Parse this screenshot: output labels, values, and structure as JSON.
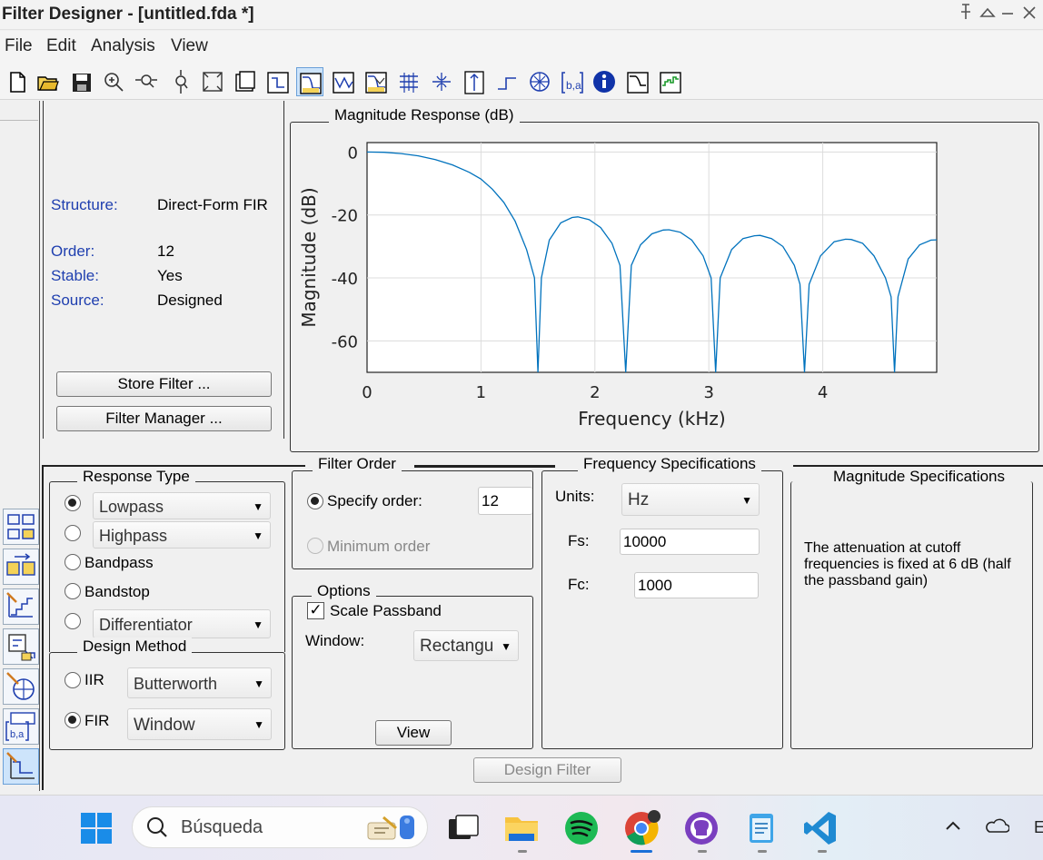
{
  "window": {
    "title": "Filter Designer - [untitled.fda *]",
    "controls": [
      "pin",
      "maximize",
      "minimize"
    ]
  },
  "menu": [
    "File",
    "Edit",
    "Analysis",
    "View"
  ],
  "toolbar_icons": [
    "new-file-icon",
    "open-folder-icon",
    "save-icon",
    "zoom-in-icon",
    "zoom-x-icon",
    "zoom-y-icon",
    "full-view-icon",
    "filter-spec-icon",
    "pole-zero-spec-icon",
    "magnitude-response-icon",
    "phase-response-icon",
    "magnitude-phase-icon",
    "group-delay-icon",
    "phase-delay-icon",
    "impulse-response-icon",
    "step-response-icon",
    "pole-zero-plot-icon",
    "filter-coefficients-icon",
    "filter-information-icon",
    "magnitude-estimate-icon",
    "round-off-noise-icon"
  ],
  "info_panel": {
    "structure_label": "Structure:",
    "structure_value": "Direct-Form FIR",
    "order_label": "Order:",
    "order_value": "12",
    "stable_label": "Stable:",
    "stable_value": "Yes",
    "source_label": "Source:",
    "source_value": "Designed",
    "store_button": "Store Filter ...",
    "manager_button": "Filter Manager ..."
  },
  "plot": {
    "panel_title": "Magnitude Response (dB)",
    "line_color": "#0072bd"
  },
  "chart_data": {
    "type": "line",
    "title": "Magnitude Response (dB)",
    "xlabel": "Frequency (kHz)",
    "ylabel": "Magnitude (dB)",
    "xlim": [
      0,
      5
    ],
    "ylim": [
      -70,
      3
    ],
    "x_ticks": [
      "0",
      "1",
      "2",
      "3",
      "4"
    ],
    "y_ticks": [
      "0",
      "-20",
      "-40",
      "-60"
    ],
    "grid": true,
    "series": [
      {
        "x": [
          0,
          0.15,
          0.3,
          0.45,
          0.6,
          0.75,
          0.9,
          1.0,
          1.1,
          1.2,
          1.3,
          1.4,
          1.47,
          1.5,
          1.53,
          1.6,
          1.7,
          1.8,
          1.85,
          1.95,
          2.05,
          2.15,
          2.22,
          2.27,
          2.32,
          2.4,
          2.5,
          2.6,
          2.65,
          2.75,
          2.85,
          2.95,
          3.02,
          3.06,
          3.1,
          3.2,
          3.3,
          3.4,
          3.45,
          3.55,
          3.65,
          3.75,
          3.8,
          3.84,
          3.88,
          3.98,
          4.1,
          4.2,
          4.25,
          4.35,
          4.45,
          4.55,
          4.6,
          4.63,
          4.66,
          4.75,
          4.85,
          4.95,
          5.0
        ],
        "y": [
          0,
          -0.1,
          -0.5,
          -1.2,
          -2.4,
          -4.1,
          -6.5,
          -8.6,
          -11.8,
          -16.0,
          -22.0,
          -31.0,
          -40.0,
          -70,
          -40.0,
          -28.0,
          -22.5,
          -20.8,
          -20.6,
          -21.5,
          -24.0,
          -29.0,
          -36.0,
          -70,
          -36.0,
          -29.5,
          -26.0,
          -24.8,
          -24.7,
          -25.5,
          -28.0,
          -33.0,
          -40.0,
          -70,
          -40.0,
          -31.0,
          -27.5,
          -26.6,
          -26.5,
          -27.5,
          -30.0,
          -36.0,
          -42.0,
          -70,
          -42.0,
          -33.0,
          -28.5,
          -27.7,
          -27.8,
          -29.0,
          -33.0,
          -40.0,
          -46.0,
          -70,
          -46.0,
          -34.0,
          -29.5,
          -28.0,
          -27.9
        ]
      }
    ]
  },
  "filter_config": {
    "response_type": {
      "title": "Response Type",
      "lowpass": "Lowpass",
      "highpass": "Highpass",
      "bandpass": "Bandpass",
      "bandstop": "Bandstop",
      "differentiator": "Differentiator",
      "selected": "Lowpass"
    },
    "design_method": {
      "title": "Design Method",
      "iir_label": "IIR",
      "iir_type": "Butterworth",
      "fir_label": "FIR",
      "fir_type": "Window",
      "selected": "FIR"
    },
    "filter_order": {
      "title": "Filter Order",
      "specify_label": "Specify order:",
      "specify_value": "12",
      "minimum_label": "Minimum order",
      "selected": "Specify order"
    },
    "options": {
      "title": "Options",
      "scale_passband": "Scale Passband",
      "scale_checked": true,
      "window_label": "Window:",
      "window_value": "Rectangu",
      "view_button": "View"
    },
    "frequency_specs": {
      "title": "Frequency Specifications",
      "units_label": "Units:",
      "units_value": "Hz",
      "fs_label": "Fs:",
      "fs_value": "10000",
      "fc_label": "Fc:",
      "fc_value": "1000"
    },
    "magnitude_specs": {
      "title": "Magnitude Specifications",
      "note": "The attenuation at cutoff frequencies is fixed at 6 dB (half the passband gain)"
    },
    "design_button": "Design Filter"
  },
  "sidebar_icons": [
    "transform-filter-icon",
    "multirate-filter-icon",
    "quantize-filter-icon",
    "realize-model-icon",
    "pole-zero-editor-icon",
    "import-filter-icon",
    "design-filter-icon"
  ],
  "taskbar": {
    "search_placeholder": "Búsqueda",
    "apps": [
      "start-icon",
      "search-icon",
      "task-view-icon",
      "file-explorer-icon",
      "spotify-icon",
      "chrome-icon",
      "github-desktop-icon",
      "notepad-icon",
      "vscode-icon"
    ],
    "tray": [
      "chevron-up-icon",
      "onedrive-icon"
    ],
    "tray_text": "E"
  }
}
